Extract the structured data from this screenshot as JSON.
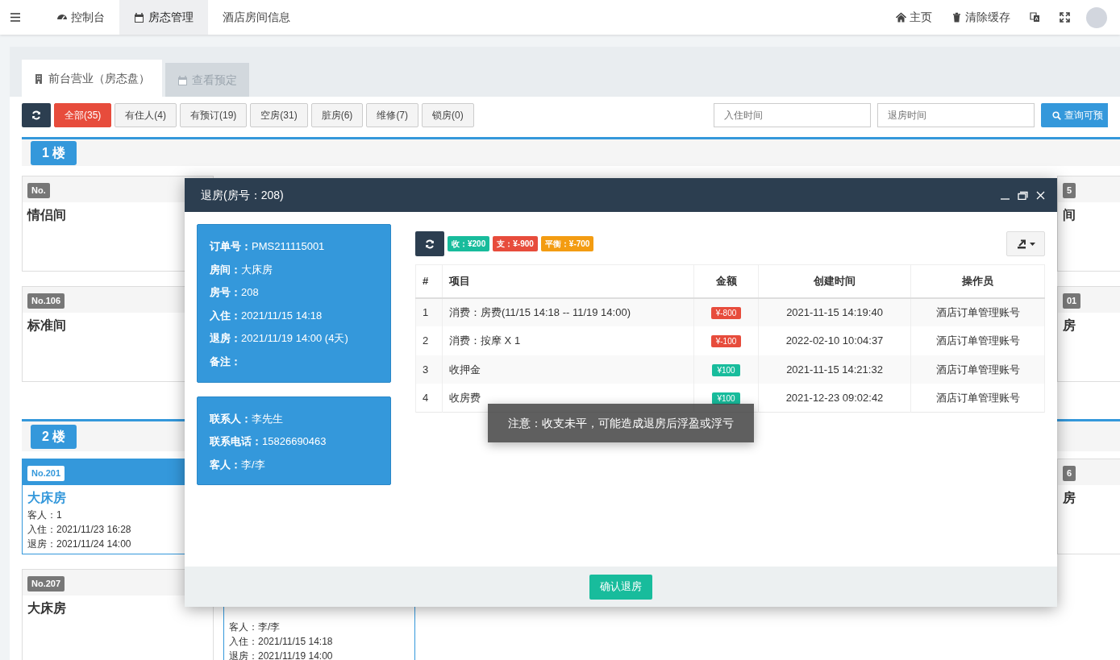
{
  "navbar": {
    "tabs": [
      {
        "label": "控制台",
        "kind": "dashboard",
        "selected": false
      },
      {
        "label": "房态管理",
        "kind": "calendar",
        "selected": true
      },
      {
        "label": "酒店房间信息",
        "kind": "none",
        "selected": false
      }
    ],
    "actions": [
      {
        "label": "主页",
        "kind": "home"
      },
      {
        "label": "清除缓存",
        "kind": "trash"
      },
      {
        "kind": "translate"
      },
      {
        "kind": "fullscreen"
      }
    ]
  },
  "page_tabs": [
    {
      "label": "前台营业（房态盘）",
      "kind": "building",
      "selected": true
    },
    {
      "label": "查看预定",
      "kind": "calendar",
      "selected": false
    }
  ],
  "filters": [
    {
      "label": "全部(35)",
      "selected": true
    },
    {
      "label": "有住人(4)",
      "selected": false
    },
    {
      "label": "有预订(19)",
      "selected": false
    },
    {
      "label": "空房(31)",
      "selected": false
    },
    {
      "label": "脏房(6)",
      "selected": false
    },
    {
      "label": "维修(7)",
      "selected": false
    },
    {
      "label": "锁房(0)",
      "selected": false
    }
  ],
  "checkin_field": {
    "placeholder": "入住时间"
  },
  "checkout_field": {
    "placeholder": "退房时间"
  },
  "search_button": "查询可预",
  "floors": [
    {
      "title": "1 楼",
      "rows": [
        {
          "left": {
            "number": "No.",
            "name": "情侣间",
            "occupied": false
          },
          "right": {
            "number": "5",
            "name": "间"
          }
        },
        {
          "left": {
            "number": "No.106",
            "name": "标准间",
            "occupied": false
          },
          "right": {
            "number": "01",
            "name": "房"
          }
        }
      ]
    },
    {
      "title": "2 楼",
      "rows": [
        {
          "left": {
            "number": "No.201",
            "name": "大床房",
            "occupied": true,
            "lines": [
              "客人：1",
              "入住：2021/11/23 16:28",
              "退房：2021/11/24 14:00"
            ]
          },
          "right": {
            "number": "6",
            "name": "房"
          }
        },
        {
          "left": {
            "number": "No.207",
            "name": "大床房",
            "occupied": false
          },
          "second": {
            "occupied": true,
            "lines": [
              "客人：李/李",
              "入住：2021/11/15 14:18",
              "退房：2021/11/19 14:00"
            ]
          }
        }
      ]
    }
  ],
  "modal": {
    "title": "退房(房号：208)",
    "order_info": [
      "**订单号：**PMS211115001",
      "**房间：**大床房",
      "**房号：**208",
      "**入住：**2021/11/15 14:18",
      "**退房：**2021/11/19 14:00 (4天)",
      "**备注：**"
    ],
    "contact_info": [
      "**联系人：**李先生",
      "**联系电话：**15826690463",
      "**客人：**李/李"
    ],
    "badges": [
      {
        "text": "收：¥200",
        "color": "#18bc9c"
      },
      {
        "text": "支：¥-900",
        "color": "#e74c3c"
      },
      {
        "text": "平衡：¥-700",
        "color": "#f39c12"
      }
    ],
    "columns": [
      "#",
      "项目",
      "金额",
      "创建时间",
      "操作员"
    ],
    "rows": [
      {
        "no": "1",
        "item": "消费：房费(11/15 14:18 -- 11/19 14:00)",
        "amount": "¥-800",
        "kind": "expense",
        "time": "2021-11-15 14:19:40",
        "operator": "酒店订单管理账号"
      },
      {
        "no": "2",
        "item": "消费：按摩 X 1",
        "amount": "¥-100",
        "kind": "expense",
        "time": "2022-02-10 10:04:37",
        "operator": "酒店订单管理账号"
      },
      {
        "no": "3",
        "item": "收押金",
        "amount": "¥100",
        "kind": "income",
        "time": "2021-11-15 14:21:32",
        "operator": "酒店订单管理账号"
      },
      {
        "no": "4",
        "item": "收房费",
        "amount": "¥100",
        "kind": "income",
        "time": "2021-12-23 09:02:42",
        "operator": "酒店订单管理账号"
      }
    ],
    "toast": "注意：收支未平，可能造成退房后浮盈或浮亏",
    "confirm_button": "确认退房"
  }
}
